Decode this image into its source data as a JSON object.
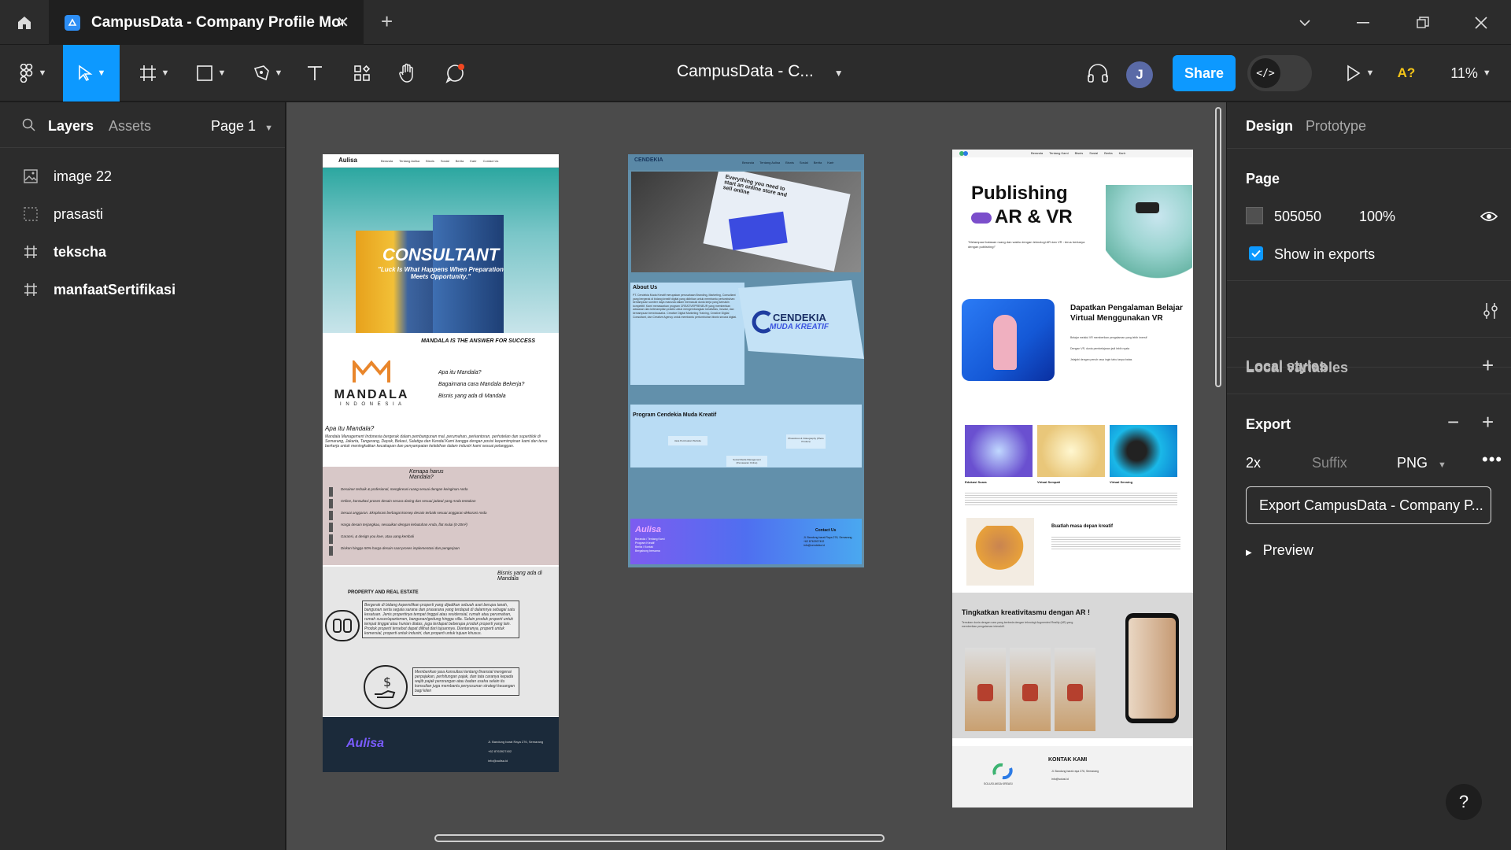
{
  "tabbar": {
    "tab_title": "CampusData - Company Profile Mockup",
    "close_glyph": "✕",
    "new_tab_glyph": "+"
  },
  "toolbar": {
    "doc_title": "CampusData - C...",
    "share_label": "Share",
    "avatar_initial": "J",
    "dev_mode_glyph": "</>",
    "missing_fonts_label": "A?",
    "zoom_label": "11%"
  },
  "left_panel": {
    "tabs": [
      "Layers",
      "Assets"
    ],
    "page_selector": "Page 1",
    "layers": [
      {
        "name": "image 22",
        "icon": "image-icon"
      },
      {
        "name": "prasasti",
        "icon": "dashed-frame-icon"
      },
      {
        "name": "tekscha",
        "icon": "frame-hash-icon"
      },
      {
        "name": "manfaatSertifikasi",
        "icon": "frame-hash-icon"
      }
    ]
  },
  "right_panel": {
    "tabs": [
      "Design",
      "Prototype"
    ],
    "page_section": {
      "title": "Page",
      "bg_color_hex": "505050",
      "opacity": "100%",
      "show_in_exports_label": "Show in exports",
      "show_in_exports_checked": true
    },
    "local_variables_label": "Local variables",
    "local_styles_label": "Local styles",
    "export_section": {
      "title": "Export",
      "scale": "2x",
      "suffix_placeholder": "Suffix",
      "format": "PNG",
      "export_button_label": "Export CampusData - Company P...",
      "preview_label": "Preview"
    }
  },
  "help_label": "?",
  "frames": {
    "aulisa": {
      "brand": "Aulisa",
      "nav": [
        "Beranda",
        "Tentang Aulisa",
        "Bisnis",
        "Sosial",
        "Berita",
        "Karir",
        "Contact Us"
      ],
      "hero_title": "CONSULTANT",
      "hero_quote": "\"Luck Is What Happens When Preparation Meets Opportunity.\"",
      "tagline": "MANDALA IS THE ANSWER FOR SUCCESS",
      "logo_name": "MANDALA",
      "logo_sub": "I N D O N E S I A",
      "questions": [
        "Apa itu Mandala?",
        "Bagaimana cara Mandala Bekerja?",
        "Bisnis yang ada di Mandala"
      ],
      "about_title": "Apa itu Mandala?",
      "about_text": "Mandala Management Indonesia bergerak dalam pembangunan mal, perumahan, perkantoran, perhotelan dan superblok di Semarang, Jakarta, Tangerang, Depok, Bekasi, Salatiga dan Kendal.Kami bangga dengan posisi kepemimpinan kami dan terus berkerja untuk meningkatkan kecakapan dan penyampaian kelebihan dalam industri kami sesuai pelanggan.",
      "why_title": "Kenapa harus Mandala?",
      "why_items": [
        "Desainer terbaik & profesional, mengkreasi ruang sesuai dengan keinginan Anda",
        "Online, konsultasi proses desain secara daring dan sesuai jadwal yang Anda tentukan",
        "Sesuai anggaran. Eksplorasi berbagai konsep desain terbaik sesuai anggaran dekorasi Anda",
        "Harga desain terjangkau, sesuaikan dengan kebutuhan Anda, flat mulai (0-20m²)",
        "Garansi, & design you love, atau uang kembali",
        "Diskon hingga 50% harga desain saat proses implementasi dan pengerjaan"
      ],
      "biz_title": "Bisnis yang ada di Mandala",
      "property_title": "PROPERTY AND REAL ESTATE",
      "property_text": "Bergerak di bidang kepemilikan properti yang dijadikan sebuah aset berupa tanah, bangunan serta segala sarana dan prasarana yang terdapat di dalamnya sebagai satu kesatuan. Jenis propertinya tempat tinggal atau residensial, rumah atau perumahan, rumah susun/apartemen, bangunan/gedung hingga villa. Selain produk properti untuk tempat tinggal atau hunian diatas, juga terdapat beberapa produk properti yang lain. Produk properti tersebut dapat dilihat dari tujuannya. Diantaranya, properti untuk komersial, properti untuk industri, dan properti untuk tujuan khusus.",
      "consult_text": "Memberikan jasa konsultasi tentang finansial mengenai perpajakan, perhitungan pajak, dan tata caranya kepada wajib pajak perorangan atau badan usaha selain itu konsultan juga membantu penyusunan strategi keuangan bagi klien",
      "footer_brand": "Aulisa",
      "footer_address": "Jl. Bandung barat Raya 276, Semarang",
      "footer_phone": "+62 8763927402",
      "footer_email": "info@aulisa.id"
    },
    "cendekia": {
      "brand_top": "CENDEKIA",
      "nav": [
        "Beranda",
        "Tentang Aulisa",
        "Bisnis",
        "Sosial",
        "Berita",
        "Karir"
      ],
      "hero_caption": "Everything you need to start an online store and sell online",
      "about_title": "About Us",
      "about_text": "PT. Cendekia Muda Kreatif merupakan perusahaan Branding, Marketing, Consultant yang bergerak di bidang kreatif digital yang didirikan untuk membantu pertumbuhan kemampuan sumber daya manusia dalam memasuki dunia kerja yang semakin kompetitif. Kami menawarkan program CREATIVEPRENEUR yang memberikan wawasan dan keterampilan praktis untuk mengembangkan kreativitas, inovasi, dan kemampuan berwirausaha. Creative Digital Marketing Training, Creative Digital Consultant, dan Creative Agency untuk membantu pertumbuhan bisnis secara digital.",
      "logo_line1": "CENDEKIA",
      "logo_line2": "MUDA KREATIF",
      "program_title": "Program Cendekia Muda Kreatif",
      "programs": [
        "Jasa Pembuatan Website",
        "Photoshoot & Videography (Photo Product)",
        "Social Media Management (Pemasaran Online)"
      ],
      "footer_brand": "Aulisa",
      "footer_links": [
        "Beranda / Tentang Kami",
        "Program Kreatif",
        "Berita / Kontak",
        "Bergabung bersama"
      ],
      "contact_title": "Contact Us",
      "contact_items": [
        "Jl. Bandung barat Raya 276, Semarang",
        "+62 8763927402",
        "info@cendekia.id"
      ]
    },
    "solusi": {
      "nav": [
        "Beranda",
        "Tentang Kami",
        "Bisnis",
        "Sosial",
        "Berita",
        "Karir"
      ],
      "hero_title_1": "Publishing",
      "hero_title_2": "AR & VR",
      "hero_sub": "\"Melampaui batasan ruang dan waktu dengan teknologi AR dan VR : terus berkarya dengan publishing!\"",
      "vr_title": "Dapatkan Pengalaman Belajar Virtual Menggunakan VR",
      "vr_points": [
        "Belajar melalui VR memberikan pengalaman yang lebih imersif",
        "Dengan VR, dunia pembelajaran jadi lebih nyata",
        "Jelajahi dengan penuh rasa ingin tahu tanpa batas"
      ],
      "cards": [
        "Edukasi Suara",
        "Virtual Sempati",
        "Virtual Sensing"
      ],
      "future_title": "Buatlah masa depan kreatif",
      "ar_title": "Tingkatkan kreativitasmu dengan  AR !",
      "ar_text": "Temukan dunia dengan cara yang berbeda dengan teknologi Augmented Reality (AR) yang memberikan pengalaman interaktif.",
      "contact_title": "KONTAK KAMI",
      "contact_address": "Jl. Bandung barat raya 276, Semarang",
      "contact_email": "info@solusi.id",
      "logo_text": "SOLUSI AKSA KREASI"
    }
  },
  "colors": {
    "accent": "#0d99ff",
    "panel": "#2c2c2c",
    "canvas": "#4b4b4b",
    "cendekia_bg": "#6290ab",
    "aulisa_footer": "#1b2a3a"
  }
}
